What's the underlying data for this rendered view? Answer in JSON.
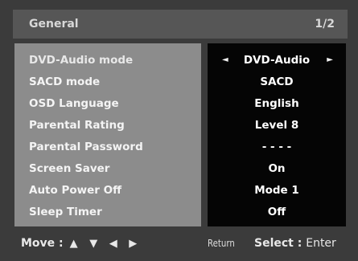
{
  "header": {
    "title": "General",
    "page": "1/2"
  },
  "settings": [
    {
      "label": "DVD-Audio mode",
      "value": "DVD-Audio"
    },
    {
      "label": "SACD mode",
      "value": "SACD"
    },
    {
      "label": "OSD Language",
      "value": "English"
    },
    {
      "label": "Parental Rating",
      "value": "Level  8"
    },
    {
      "label": "Parental Password",
      "value": "- - - -"
    },
    {
      "label": "Screen Saver",
      "value": "On"
    },
    {
      "label": "Auto Power Off",
      "value": "Mode  1"
    },
    {
      "label": "Sleep Timer",
      "value": "Off"
    }
  ],
  "footer": {
    "move_label": "Move :",
    "up_glyph": "▲",
    "down_glyph": "▼",
    "left_glyph": "◀",
    "right_glyph": "▶",
    "return_label": "Return",
    "select_label": "Select :",
    "enter_label": "Enter"
  },
  "arrows": {
    "left": "◄",
    "right": "►"
  }
}
